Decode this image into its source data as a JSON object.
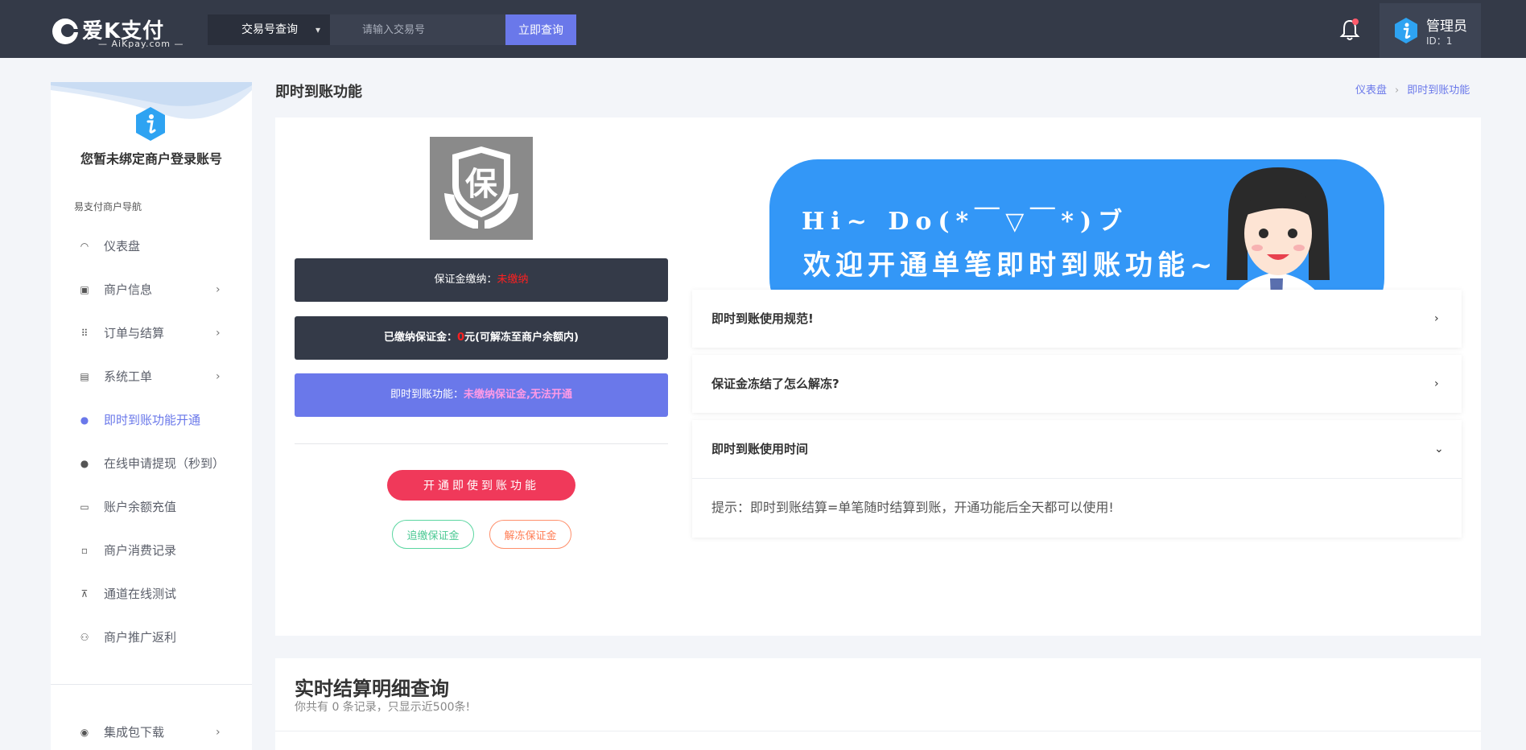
{
  "brand": {
    "name": "爱K支付",
    "sub": "— AiKpay.com —"
  },
  "search": {
    "select_label": "交易号查询",
    "placeholder": "请输入交易号",
    "button": "立即查询"
  },
  "user": {
    "name": "管理员",
    "id": "ID：1"
  },
  "sidebar": {
    "notice": "您暂未绑定商户登录账号",
    "section": "易支付商户导航",
    "items": [
      {
        "label": "仪表盘"
      },
      {
        "label": "商户信息",
        "arrow": "›"
      },
      {
        "label": "订单与结算",
        "arrow": "›"
      },
      {
        "label": "系统工单",
        "arrow": "›"
      },
      {
        "label": "即时到账功能开通"
      },
      {
        "label": "在线申请提现（秒到）"
      },
      {
        "label": "账户余额充值"
      },
      {
        "label": "商户消费记录"
      },
      {
        "label": "通道在线测试"
      },
      {
        "label": "商户推广返利"
      }
    ],
    "bottom_item": {
      "label": "集成包下载",
      "arrow": "›"
    }
  },
  "page": {
    "title": "即时到账功能"
  },
  "breadcrumb": {
    "home": "仪表盘",
    "sep": "›",
    "current": "即时到账功能"
  },
  "shield": {
    "char": "保"
  },
  "deposit": {
    "paid_label": "保证金缴纳：",
    "paid_value": "未缴纳",
    "amount_label": "已缴纳保证金：",
    "amount_value": "0",
    "amount_suffix": "元(可解冻至商户余额内)",
    "instant_label": "即时到账功能：",
    "instant_value": "未缴纳保证金,无法开通"
  },
  "actions": {
    "open": "开通即使到账功能",
    "add": "追缴保证金",
    "unfreeze": "解冻保证金"
  },
  "banner": {
    "hi": "Hi~ Do(*￣▽￣*)ブ",
    "welcome": "欢迎开通单笔即时到账功能~"
  },
  "faq": [
    {
      "q": "即时到账使用规范!",
      "arrow": "›"
    },
    {
      "q": "保证金冻结了怎么解冻?",
      "arrow": "›"
    },
    {
      "q": "即时到账使用时间",
      "arrow": "⌄",
      "answer": "提示：即时到账结算=单笔随时结算到账，开通功能后全天都可以使用!"
    }
  ],
  "records": {
    "title": "实时结算明细查询",
    "summary": "你共有 0 条记录，只显示近500条!"
  },
  "colors": {
    "topbar": "#343a48",
    "accent": "#6a78ea",
    "danger": "#f0395a",
    "banner": "#3397f7"
  }
}
